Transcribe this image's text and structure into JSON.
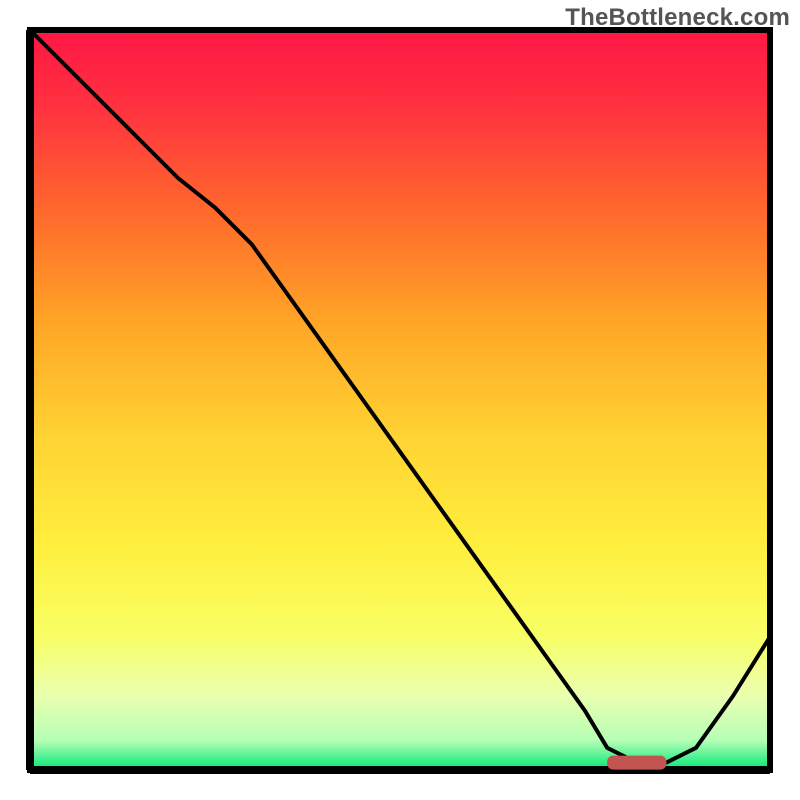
{
  "watermark": "TheBottleneck.com",
  "chart_data": {
    "type": "line",
    "title": "",
    "xlabel": "",
    "ylabel": "",
    "xlim": [
      0,
      100
    ],
    "ylim": [
      0,
      100
    ],
    "x": [
      0,
      5,
      10,
      15,
      20,
      25,
      30,
      35,
      40,
      45,
      50,
      55,
      60,
      65,
      70,
      75,
      78,
      82,
      86,
      90,
      95,
      100
    ],
    "values": [
      100,
      95,
      90,
      85,
      80,
      76,
      71,
      64,
      57,
      50,
      43,
      36,
      29,
      22,
      15,
      8,
      3,
      1,
      1,
      3,
      10,
      18
    ],
    "marker": {
      "x_start": 78,
      "x_end": 86,
      "y": 1
    },
    "gradient_stops": [
      {
        "offset": 0.0,
        "color": "#ff1744"
      },
      {
        "offset": 0.1,
        "color": "#ff3040"
      },
      {
        "offset": 0.25,
        "color": "#ff6a2c"
      },
      {
        "offset": 0.4,
        "color": "#ffa726"
      },
      {
        "offset": 0.55,
        "color": "#ffd333"
      },
      {
        "offset": 0.7,
        "color": "#ffef3e"
      },
      {
        "offset": 0.82,
        "color": "#f8ff66"
      },
      {
        "offset": 0.9,
        "color": "#eaffb0"
      },
      {
        "offset": 0.96,
        "color": "#b6ffb6"
      },
      {
        "offset": 1.0,
        "color": "#00e676"
      }
    ],
    "marker_color": "#c2554f",
    "curve_color": "#000000",
    "frame_color": "#000000"
  }
}
